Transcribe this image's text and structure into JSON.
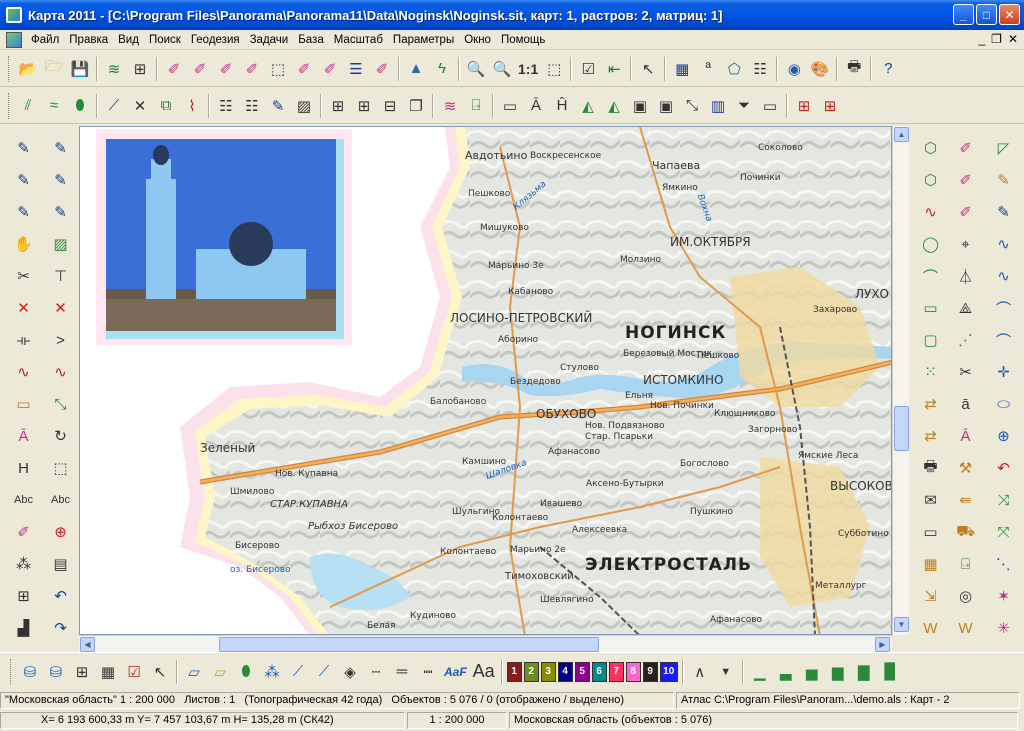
{
  "window": {
    "title": "Карта 2011 - [C:\\Program Files\\Panorama\\Panorama11\\Data\\Noginsk\\Noginsk.sit, карт: 1, растров: 2, матриц: 1]",
    "minimize": "_",
    "maximize": "□",
    "close": "✕"
  },
  "menu": {
    "items": [
      "Файл",
      "Правка",
      "Вид",
      "Поиск",
      "Геодезия",
      "Задачи",
      "База",
      "Масштаб",
      "Параметры",
      "Окно",
      "Помощь"
    ],
    "mdi_minimize": "_",
    "mdi_restore": "❐",
    "mdi_close": "✕"
  },
  "toolbar1": {
    "scale_one_to_one": "1:1"
  },
  "bottombar": {
    "text_style_small": "AaF",
    "text_style_large": "Aa",
    "layers": [
      {
        "label": "1",
        "color": "#8b1a1a"
      },
      {
        "label": "2",
        "color": "#6b8e23"
      },
      {
        "label": "3",
        "color": "#8b8b00"
      },
      {
        "label": "4",
        "color": "#00008b"
      },
      {
        "label": "5",
        "color": "#8b008b"
      },
      {
        "label": "6",
        "color": "#008b8b"
      },
      {
        "label": "7",
        "color": "#ff3366"
      },
      {
        "label": "8",
        "color": "#ff66cc"
      },
      {
        "label": "9",
        "color": "#222222"
      },
      {
        "label": "10",
        "color": "#1a1aff"
      }
    ]
  },
  "status1": {
    "map_name": "\"Московская область\"",
    "scale": "1 : 200 000",
    "sheets": "Листов : 1",
    "classifier": "(Топографическая 42 года)",
    "objects": "Объектов : 5 076 / 0 (отображено / выделено)",
    "atlas": "Атлас C:\\Program Files\\Panoram...\\demo.als : Карт - 2"
  },
  "status2": {
    "coords": "X= 6 193 600,33 m  Y= 7 457 103,67 m  H=  135,28 m  (СК42)",
    "scale": "1 : 200 000",
    "region": "Московская область   (объектов : 5 076)"
  },
  "map": {
    "cities": [
      "НОГИНСК",
      "ЭЛЕКТРОСТАЛЬ"
    ],
    "towns": [
      "ЛОСИНО-ПЕТРОВСКИЙ",
      "ИМ.ОКТЯБРЯ",
      "ИСТОМКИНО",
      "СТАР.КУПАВНА",
      "ЛУХО",
      "ВЫСОКОВО",
      "ОБУХОВО",
      "Зеленый"
    ],
    "villages": [
      "Авдотьино",
      "Воскресенское",
      "Чапаева",
      "Соколово",
      "Починки",
      "Ямкино",
      "Пешково",
      "Мишуково",
      "Мальцево",
      "Молзино",
      "Марьино 3е",
      "Кабаново",
      "Аборино",
      "Захарово",
      "Березовый Мостик",
      "Стулово",
      "Пешково",
      "Бездедово",
      "Балобаново",
      "Ельня",
      "Нов. Починки",
      "Клюшниково",
      "Нов. Подвязново",
      "Стар. Псарьки",
      "Загорново",
      "Ямские Леса",
      "Афанасово",
      "Камшино",
      "Богослово",
      "Аксено-Бутырки",
      "Ивашево",
      "Колонтаево",
      "Пушкино",
      "Шульгино",
      "Мальцево",
      "Алексеевка",
      "Марьино 2е",
      "Колонтаево",
      "Тимоховский",
      "Субботино",
      "Металлург",
      "Кудиново",
      "Белая",
      "Афанасово",
      "Шевлягино",
      "Шмилово",
      "Нов. Купавна",
      "Бисерово",
      "Рыбхоз Бисерово",
      "оз. Бисерово"
    ],
    "rivers": [
      "Клязьма",
      "Шаловка",
      "Вохна"
    ]
  }
}
